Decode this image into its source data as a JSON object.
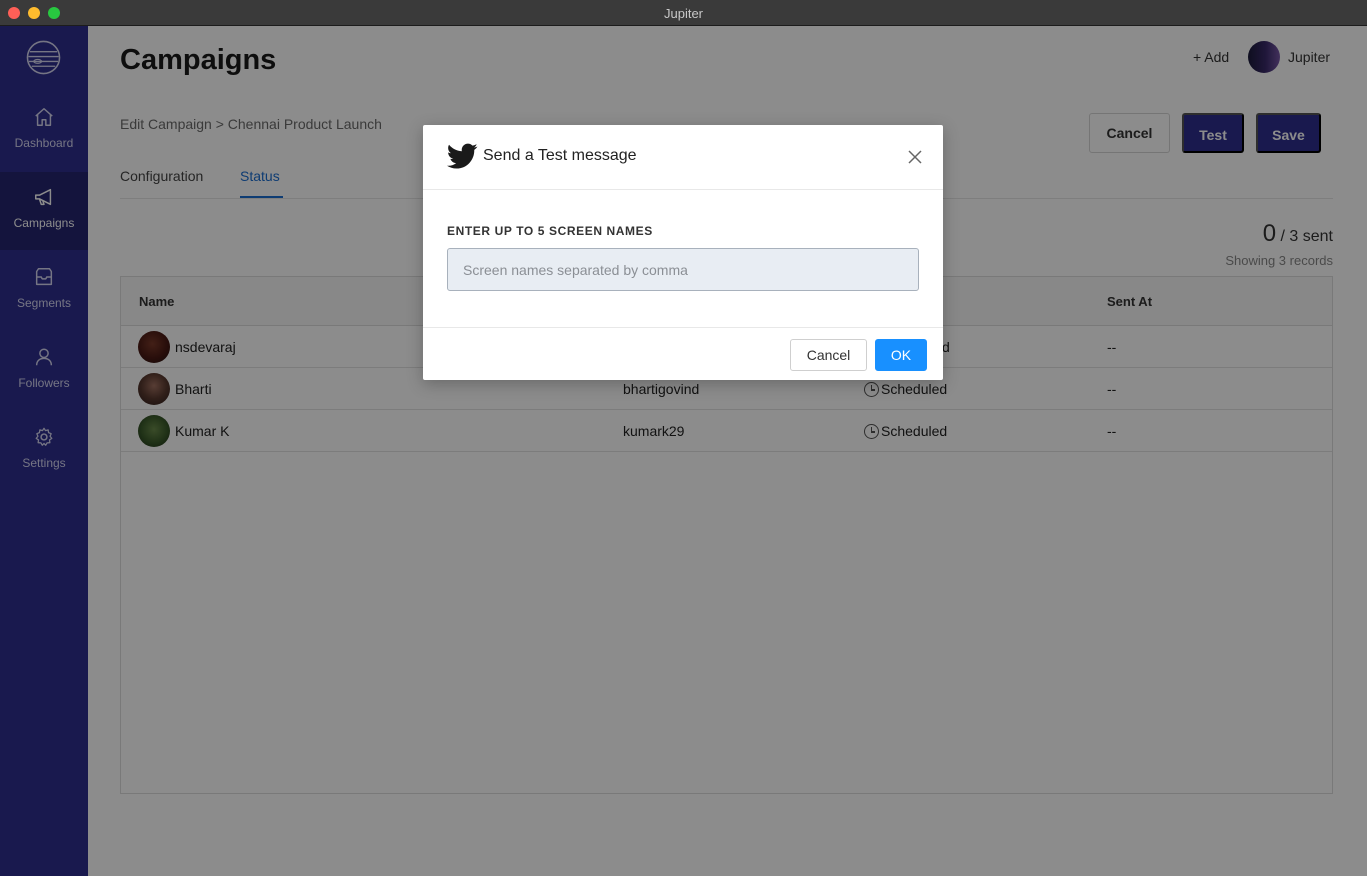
{
  "window": {
    "title": "Jupiter"
  },
  "sidebar": {
    "items": [
      {
        "label": "Dashboard",
        "icon": "home-icon"
      },
      {
        "label": "Campaigns",
        "icon": "megaphone-icon",
        "active": true
      },
      {
        "label": "Segments",
        "icon": "inbox-icon"
      },
      {
        "label": "Followers",
        "icon": "user-icon"
      },
      {
        "label": "Settings",
        "icon": "gear-icon"
      }
    ]
  },
  "header": {
    "title": "Campaigns",
    "add_label": "+ Add",
    "user_name": "Jupiter"
  },
  "breadcrumb": "Edit Campaign > Chennai Product Launch",
  "toolbar": {
    "cancel_label": "Cancel",
    "test_label": "Test",
    "save_label": "Save"
  },
  "tabs": [
    {
      "label": "Configuration"
    },
    {
      "label": "Status",
      "active": true
    }
  ],
  "stats": {
    "sent": "0",
    "total": "/ 3 sent",
    "records": "Showing 3 records"
  },
  "table": {
    "columns": [
      "Name",
      "Sent At"
    ],
    "rows": [
      {
        "name": "nsdevaraj",
        "screen_name": "",
        "status": "d",
        "sent_at": "--"
      },
      {
        "name": "Bharti",
        "screen_name": "bhartigovind",
        "status": "Scheduled",
        "sent_at": "--"
      },
      {
        "name": "Kumar K",
        "screen_name": "kumark29",
        "status": "Scheduled",
        "sent_at": "--"
      }
    ]
  },
  "modal": {
    "title": "Send a Test message",
    "field_label": "ENTER UP TO 5 SCREEN NAMES",
    "input_placeholder": "Screen names separated by comma",
    "input_value": "",
    "cancel_label": "Cancel",
    "ok_label": "OK",
    "icon": "twitter-bird-icon"
  },
  "colors": {
    "sidebar": "#2f2f8f",
    "primary_button": "#2f2f8f",
    "accent": "#1a6dd1",
    "ok_button": "#1890ff"
  }
}
